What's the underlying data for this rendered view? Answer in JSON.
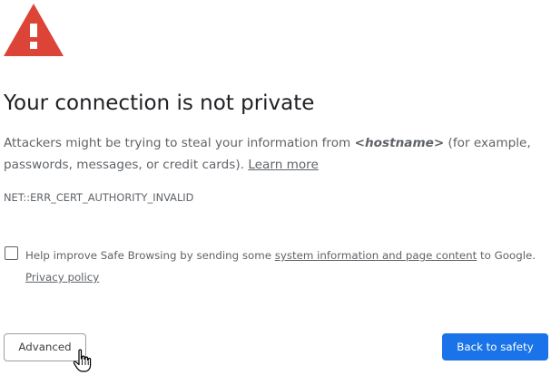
{
  "header": {
    "icon": "warning-triangle-icon",
    "icon_color": "#db4437",
    "title": "Your connection is not private"
  },
  "main": {
    "explanation": {
      "text_before": "Attackers might be trying to steal your information from ",
      "hostname": "<hostname>",
      "text_after": " (for example, passwords, messages, or credit cards). ",
      "learn_more": "Learn more"
    },
    "error_code": "NET::ERR_CERT_AUTHORITY_INVALID"
  },
  "opt_in": {
    "checked": false,
    "text_before": "Help improve Safe Browsing by sending some ",
    "link_label": "system information and page content",
    "text_after": " to Google. ",
    "privacy_label": "Privacy policy"
  },
  "buttons": {
    "advanced": "Advanced",
    "back_to_safety": "Back to safety"
  },
  "colors": {
    "primary_button": "#1a73e8",
    "text_secondary": "#5f6368",
    "text_primary": "#202124"
  },
  "cursor": "hand-pointer-icon"
}
